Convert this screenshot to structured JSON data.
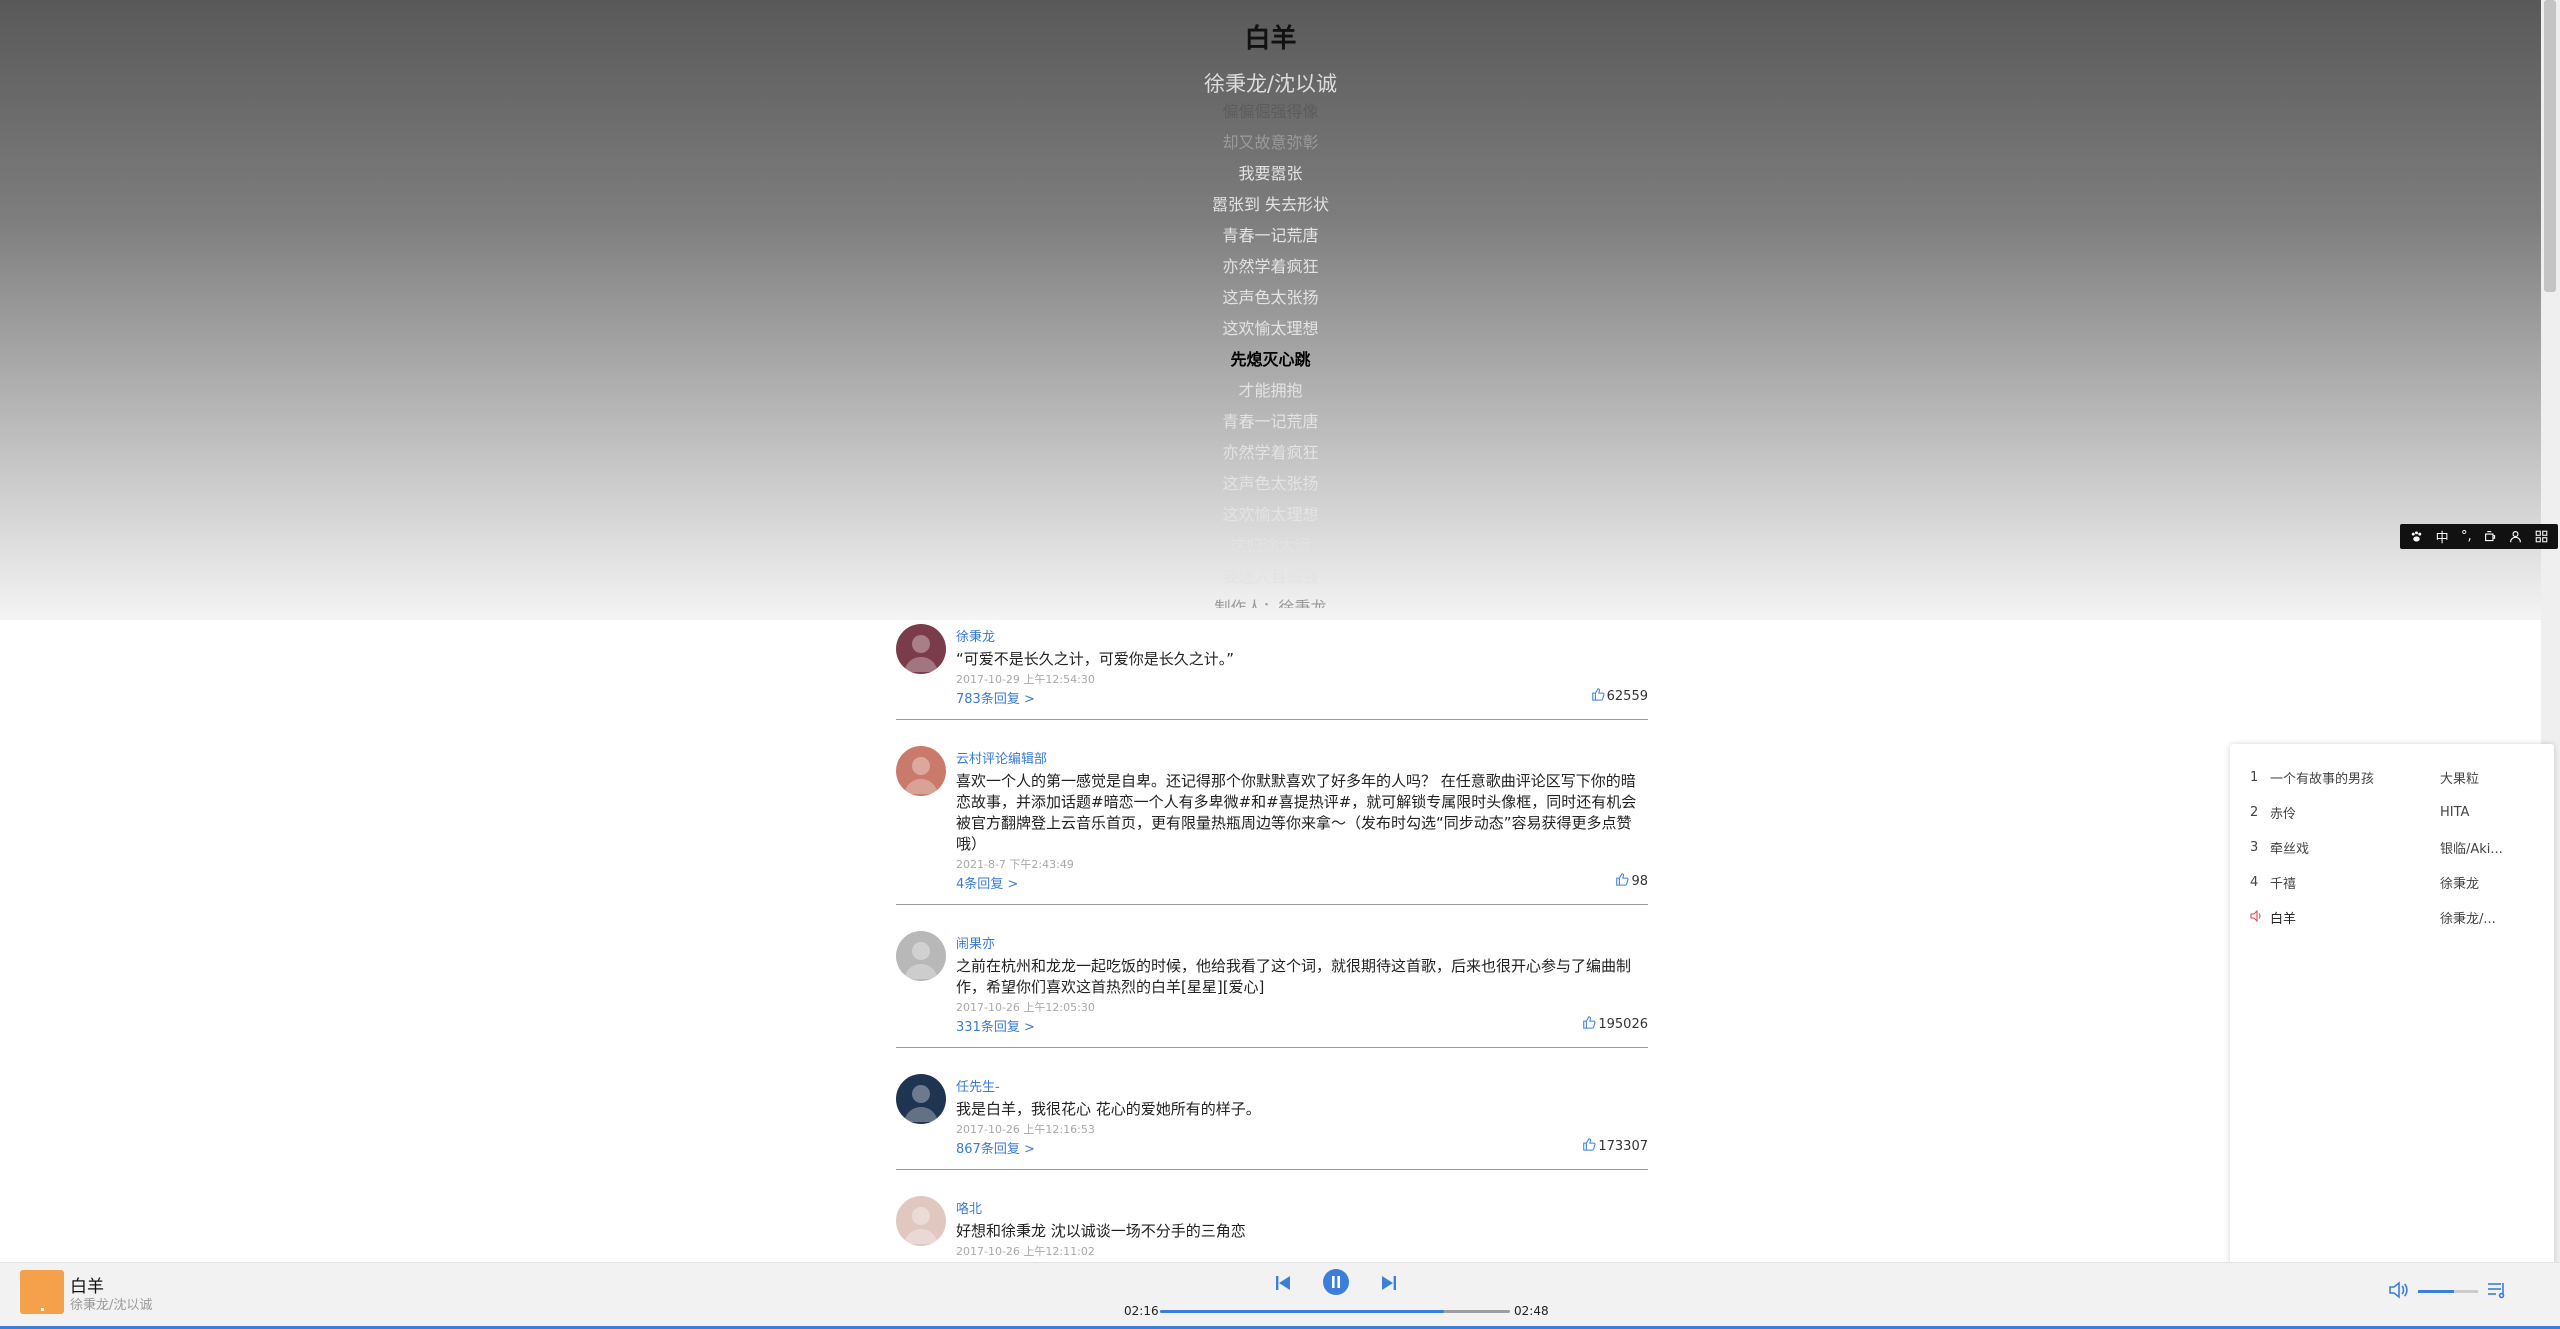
{
  "song": {
    "title": "白羊",
    "artist": "徐秉龙/沈以诚"
  },
  "lyrics": [
    {
      "text": "偏偏倔强得像",
      "state": "lightgrey"
    },
    {
      "text": "却又故意弥彰",
      "state": "dim"
    },
    {
      "text": "我要嚣张",
      "state": "normal"
    },
    {
      "text": "嚣张到 失去形状",
      "state": "normal"
    },
    {
      "text": "青春一记荒唐",
      "state": "normal"
    },
    {
      "text": "亦然学着疯狂",
      "state": "normal"
    },
    {
      "text": "这声色太张扬",
      "state": "normal"
    },
    {
      "text": "这欢愉太理想",
      "state": "normal"
    },
    {
      "text": "先熄灭心跳",
      "state": "active"
    },
    {
      "text": "才能拥抱",
      "state": "normal"
    },
    {
      "text": "青春一记荒唐",
      "state": "normal"
    },
    {
      "text": "亦然学着疯狂",
      "state": "normal"
    },
    {
      "text": "这声色太张扬",
      "state": "normal"
    },
    {
      "text": "这欢愉太理想",
      "state": "normal"
    },
    {
      "text": "这归途太远",
      "state": "normal"
    },
    {
      "text": "要迷人且倔强",
      "state": "normal"
    },
    {
      "text": "制作人：徐秉龙",
      "state": "dim"
    }
  ],
  "comments": [
    {
      "user": "徐秉龙",
      "text": "“可爱不是长久之计，可爱你是长久之计。”",
      "time": "2017-10-29 上午12:54:30",
      "replies": "783条回复 >",
      "likes": "62559",
      "avatar_color": "#7a3b4a"
    },
    {
      "user": "云村评论编辑部",
      "text": "喜欢一个人的第一感觉是自卑。还记得那个你默默喜欢了好多年的人吗？ 在任意歌曲评论区写下你的暗恋故事，并添加话题#暗恋一个人有多卑微#和#喜提热评#，就可解锁专属限时头像框，同时还有机会被官方翻牌登上云音乐首页，更有限量热瓶周边等你来拿～（发布时勾选“同步动态”容易获得更多点赞哦）",
      "time": "2021-8-7 下午2:43:49",
      "replies": "4条回复 >",
      "likes": "98",
      "avatar_color": "#c97a6a"
    },
    {
      "user": "闹果亦",
      "text": "之前在杭州和龙龙一起吃饭的时候，他给我看了这个词，就很期待这首歌，后来也很开心参与了编曲制作，希望你们喜欢这首热烈的白羊[星星][爱心]",
      "time": "2017-10-26 上午12:05:30",
      "replies": "331条回复 >",
      "likes": "195026",
      "avatar_color": "#b8b8b8"
    },
    {
      "user": "任先生-",
      "text": "我是白羊，我很花心 花心的爱她所有的样子。",
      "time": "2017-10-26 上午12:16:53",
      "replies": "867条回复 >",
      "likes": "173307",
      "avatar_color": "#1f3450"
    },
    {
      "user": "咯北",
      "text": "好想和徐秉龙 沈以诚谈一场不分手的三角恋",
      "time": "2017-10-26 上午12:11:02",
      "replies": "",
      "likes": "",
      "avatar_color": "#e0c8c0"
    }
  ],
  "playlist": [
    {
      "num": "1",
      "name": "一个有故事的男孩",
      "artist": "大果粒",
      "playing": false
    },
    {
      "num": "2",
      "name": "赤伶",
      "artist": "HITA",
      "playing": false
    },
    {
      "num": "3",
      "name": "牵丝戏",
      "artist": "银临/Aki...",
      "playing": false
    },
    {
      "num": "4",
      "name": "千禧",
      "artist": "徐秉龙",
      "playing": false
    },
    {
      "num": "",
      "name": "白羊",
      "artist": "徐秉龙/...",
      "playing": true
    }
  ],
  "player": {
    "title": "白羊",
    "artist": "徐秉龙/沈以诚",
    "current_time": "02:16",
    "total_time": "02:48",
    "progress": 0.81,
    "volume": 0.6,
    "accent": "#3b7fd9",
    "cover_color": "#f5a04a"
  },
  "ime": {
    "mode": "中",
    "punct": "°,"
  }
}
